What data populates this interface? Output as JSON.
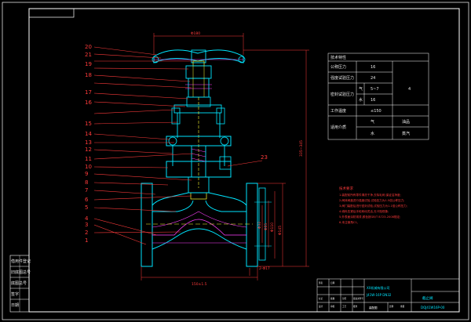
{
  "part_labels": [
    "20",
    "21",
    "19",
    "18",
    "17",
    "16",
    "15",
    "14",
    "13",
    "12",
    "11",
    "10",
    "9",
    "8",
    "7",
    "6",
    "5",
    "4",
    "3",
    "2",
    "1"
  ],
  "side_label": "23",
  "dimensions": {
    "top_width": "Φ180",
    "bottom_width": "150±1.5",
    "right_height": "335~345",
    "flange_od": "Φ145",
    "flange_bc": "Φ110",
    "flange_id": "Φ85",
    "flange_bore": "Φ32",
    "bottom_note": "2-Φ17"
  },
  "spec_table": {
    "title": "技术特性",
    "rows": [
      {
        "label": "公称压力",
        "value": "16",
        "note": ""
      },
      {
        "label": "强度试验压力",
        "value": "24",
        "note": ""
      },
      {
        "label": "密封试验压力",
        "value": "5~7",
        "sub": "气",
        "note": "4"
      },
      {
        "label": "",
        "value": "16",
        "sub": "水",
        "note": ""
      },
      {
        "label": "工作温度",
        "value": "≤150",
        "note": ""
      },
      {
        "label": "适用介质",
        "value": "气",
        "note": "油品"
      },
      {
        "label": "",
        "value": "水",
        "note": "蒸汽"
      }
    ]
  },
  "tech_requirements": {
    "title": "技术要求",
    "lines": [
      "1.装配前所有零件清洗干净,去除毛刺,保证洁净度;",
      "2.阀体阀盖进行强度试验,试验压力为1.5倍公称压力;",
      "3.阀门装配后进行密封试验,试验压力为1.1倍公称压力;",
      "4.填料压紧后手轮转动灵活,无卡阻现象;",
      "5.外表面涂防锈漆,颜色按GB/T 8723-2008规定;",
      "6.未注倒角C1。"
    ]
  },
  "title_block": {
    "company": "XX机械有限公司",
    "drawing_name": "截止阀",
    "drawing_no": "J41W-16P DN32",
    "sheet": "装配图",
    "code": "DQJ41W16P-00",
    "cells": [
      "标记",
      "处数",
      "分区",
      "更改文件号",
      "签名",
      "日期",
      "设计",
      "审核",
      "工艺",
      "批准",
      "比例",
      "重量"
    ]
  },
  "left_strip": [
    "借用件登记",
    "旧底图总号",
    "底图总号",
    "签字",
    "日期"
  ],
  "colors": {
    "background": "#000000",
    "frame": "#ffffff",
    "outline": "#00e5ff",
    "leader": "#ff3b3b",
    "hidden": "#ffff33",
    "hatch": "#ff40ff"
  }
}
